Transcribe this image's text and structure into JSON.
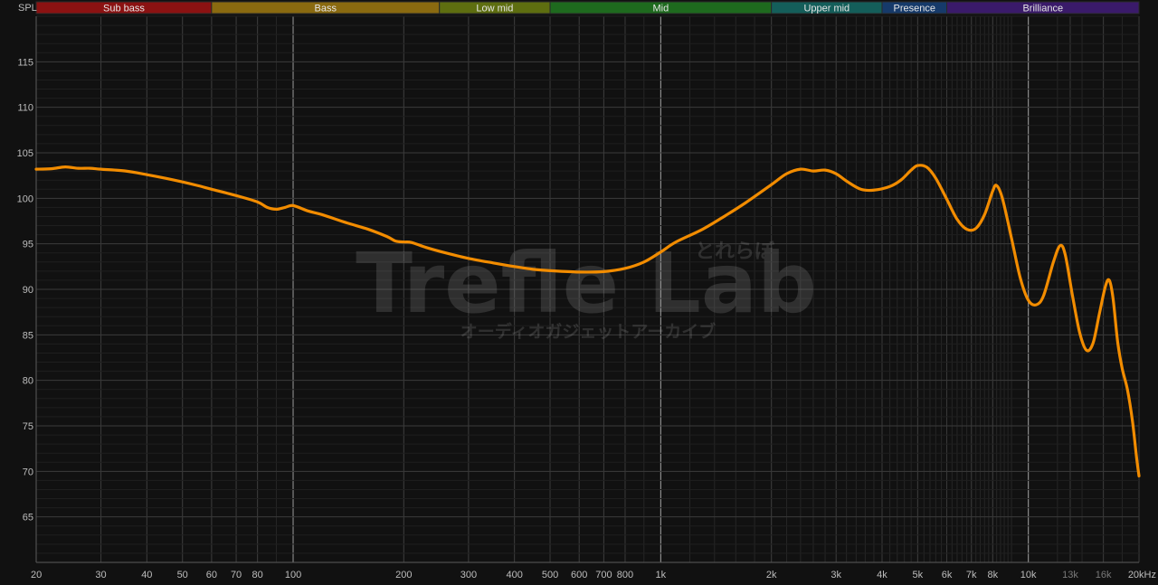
{
  "chart_data": {
    "type": "line",
    "title": "",
    "xlabel": "",
    "ylabel": "SPL",
    "x_scale": "log",
    "xlim": [
      20,
      20000
    ],
    "ylim": [
      60,
      120
    ],
    "grid": true,
    "bands": [
      {
        "name": "Sub bass",
        "from": 20,
        "to": 60,
        "color": "#8b1212"
      },
      {
        "name": "Bass",
        "from": 60,
        "to": 250,
        "color": "#8a6a10"
      },
      {
        "name": "Low mid",
        "from": 250,
        "to": 500,
        "color": "#5e6e10"
      },
      {
        "name": "Mid",
        "from": 500,
        "to": 2000,
        "color": "#1e6a1e"
      },
      {
        "name": "Upper mid",
        "from": 2000,
        "to": 4000,
        "color": "#145e5a"
      },
      {
        "name": "Presence",
        "from": 4000,
        "to": 6000,
        "color": "#163a6a"
      },
      {
        "name": "Brilliance",
        "from": 6000,
        "to": 20000,
        "color": "#3a1a6a"
      }
    ],
    "x_ticks": [
      {
        "value": 20,
        "label": "20"
      },
      {
        "value": 30,
        "label": "30"
      },
      {
        "value": 40,
        "label": "40"
      },
      {
        "value": 50,
        "label": "50"
      },
      {
        "value": 60,
        "label": "60"
      },
      {
        "value": 70,
        "label": "70"
      },
      {
        "value": 80,
        "label": "80"
      },
      {
        "value": 100,
        "label": "100"
      },
      {
        "value": 200,
        "label": "200"
      },
      {
        "value": 300,
        "label": "300"
      },
      {
        "value": 400,
        "label": "400"
      },
      {
        "value": 500,
        "label": "500"
      },
      {
        "value": 600,
        "label": "600"
      },
      {
        "value": 700,
        "label": "700"
      },
      {
        "value": 800,
        "label": "800"
      },
      {
        "value": 1000,
        "label": "1k"
      },
      {
        "value": 2000,
        "label": "2k"
      },
      {
        "value": 3000,
        "label": "3k"
      },
      {
        "value": 4000,
        "label": "4k"
      },
      {
        "value": 5000,
        "label": "5k"
      },
      {
        "value": 6000,
        "label": "6k"
      },
      {
        "value": 7000,
        "label": "7k"
      },
      {
        "value": 8000,
        "label": "8k"
      },
      {
        "value": 10000,
        "label": "10k"
      },
      {
        "value": 13000,
        "label": "13k",
        "dim": true
      },
      {
        "value": 16000,
        "label": "16k",
        "dim": true
      },
      {
        "value": 20000,
        "label": "20kHz"
      }
    ],
    "y_ticks": [
      65,
      70,
      75,
      80,
      85,
      90,
      95,
      100,
      105,
      110,
      115
    ],
    "series": [
      {
        "color": "#f28c00",
        "points": [
          [
            20,
            103.2
          ],
          [
            22,
            103.25
          ],
          [
            24,
            103.45
          ],
          [
            26,
            103.3
          ],
          [
            28,
            103.3
          ],
          [
            30,
            103.2
          ],
          [
            35,
            103.0
          ],
          [
            40,
            102.6
          ],
          [
            45,
            102.2
          ],
          [
            50,
            101.8
          ],
          [
            55,
            101.4
          ],
          [
            60,
            101.0
          ],
          [
            70,
            100.3
          ],
          [
            80,
            99.6
          ],
          [
            85,
            99.0
          ],
          [
            90,
            98.8
          ],
          [
            95,
            99.0
          ],
          [
            100,
            99.2
          ],
          [
            110,
            98.6
          ],
          [
            120,
            98.2
          ],
          [
            140,
            97.3
          ],
          [
            160,
            96.6
          ],
          [
            180,
            95.8
          ],
          [
            190,
            95.3
          ],
          [
            200,
            95.2
          ],
          [
            210,
            95.15
          ],
          [
            230,
            94.6
          ],
          [
            260,
            94.0
          ],
          [
            300,
            93.4
          ],
          [
            350,
            92.9
          ],
          [
            400,
            92.5
          ],
          [
            450,
            92.2
          ],
          [
            500,
            92.05
          ],
          [
            600,
            91.9
          ],
          [
            700,
            91.95
          ],
          [
            800,
            92.3
          ],
          [
            900,
            93.0
          ],
          [
            1000,
            94.1
          ],
          [
            1100,
            95.2
          ],
          [
            1300,
            96.6
          ],
          [
            1500,
            98.1
          ],
          [
            1700,
            99.5
          ],
          [
            2000,
            101.5
          ],
          [
            2200,
            102.7
          ],
          [
            2400,
            103.2
          ],
          [
            2600,
            103.0
          ],
          [
            2800,
            103.1
          ],
          [
            3000,
            102.7
          ],
          [
            3200,
            101.9
          ],
          [
            3500,
            101.0
          ],
          [
            3800,
            100.9
          ],
          [
            4200,
            101.3
          ],
          [
            4500,
            102.0
          ],
          [
            4800,
            103.1
          ],
          [
            5000,
            103.6
          ],
          [
            5300,
            103.4
          ],
          [
            5600,
            102.2
          ],
          [
            6000,
            99.9
          ],
          [
            6400,
            97.7
          ],
          [
            6800,
            96.6
          ],
          [
            7200,
            96.7
          ],
          [
            7600,
            98.2
          ],
          [
            8000,
            100.8
          ],
          [
            8200,
            101.4
          ],
          [
            8500,
            100.0
          ],
          [
            9000,
            95.6
          ],
          [
            9500,
            91.3
          ],
          [
            10000,
            88.8
          ],
          [
            10500,
            88.3
          ],
          [
            11000,
            89.3
          ],
          [
            11700,
            93.0
          ],
          [
            12200,
            94.8
          ],
          [
            12600,
            93.8
          ],
          [
            13200,
            89.2
          ],
          [
            13800,
            85.2
          ],
          [
            14400,
            83.3
          ],
          [
            15000,
            84.1
          ],
          [
            15600,
            87.3
          ],
          [
            16200,
            90.3
          ],
          [
            16600,
            91.0
          ],
          [
            17000,
            89.0
          ],
          [
            17500,
            84.2
          ],
          [
            18000,
            81.3
          ],
          [
            18600,
            79.0
          ],
          [
            19200,
            75.5
          ],
          [
            19700,
            71.5
          ],
          [
            20000,
            69.5
          ]
        ]
      }
    ]
  },
  "watermark": {
    "brand": "Trefle Lab",
    "kana_small": "とれらぼ",
    "subtitle": "オーディオガジェットアーカイブ"
  }
}
